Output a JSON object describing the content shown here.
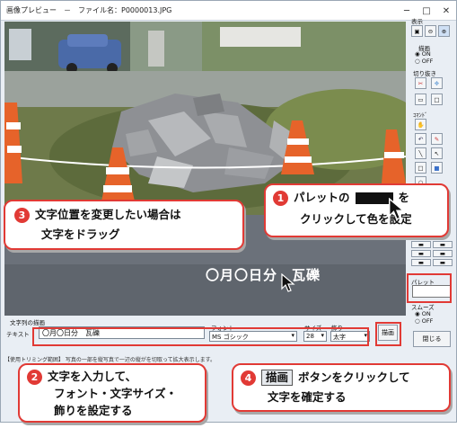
{
  "window": {
    "title": "画像プレビュー　－　ファイル名：P0000013.JPG",
    "minimize": "─",
    "maximize": "□",
    "close": "✕"
  },
  "photo": {
    "overlay_text": "〇月〇日分　瓦礫"
  },
  "panel": {
    "display_label": "表示",
    "draw_label": "描画",
    "draw_on": "ON",
    "draw_off": "OFF",
    "cut_label": "切り抜き",
    "command_label": "ｺﾏﾝﾄﾞ",
    "palette_label": "パレット",
    "smooth_label": "スムーズ",
    "smooth_on": "ON",
    "smooth_off": "OFF",
    "close_button": "閉じる"
  },
  "text_settings": {
    "section_label": "文字列の描画",
    "text_label": "テキスト",
    "text_value": "〇月〇日分　瓦礫",
    "font_label": "フォント",
    "font_value": "MS ゴシック",
    "size_label": "サイズ",
    "size_value": "28",
    "decoration_label": "飾り",
    "decoration_value": "太字",
    "draw_button": "描画"
  },
  "status": {
    "text": "【使用トリミング範囲】 写真の一部を縦写真で一辺の縦がを切取って拡大表示します。"
  },
  "callouts": {
    "c1_num": "1",
    "c1_line1_a": "パレットの",
    "c1_line1_b": "を",
    "c1_line2": "クリックして色を設定",
    "c2_num": "2",
    "c2_line1": "文字を入力して、",
    "c2_line2": "フォント・文字サイズ・",
    "c2_line3": "飾りを設定する",
    "c3_num": "3",
    "c3_line1": "文字位置を変更したい場合は",
    "c3_line2": "文字をドラッグ",
    "c4_num": "4",
    "c4_button": "描画",
    "c4_line1": "ボタンをクリックして",
    "c4_line2": "文字を確定する"
  },
  "colors": {
    "accent_red": "#e13a35",
    "palette_selected": "#111111"
  }
}
